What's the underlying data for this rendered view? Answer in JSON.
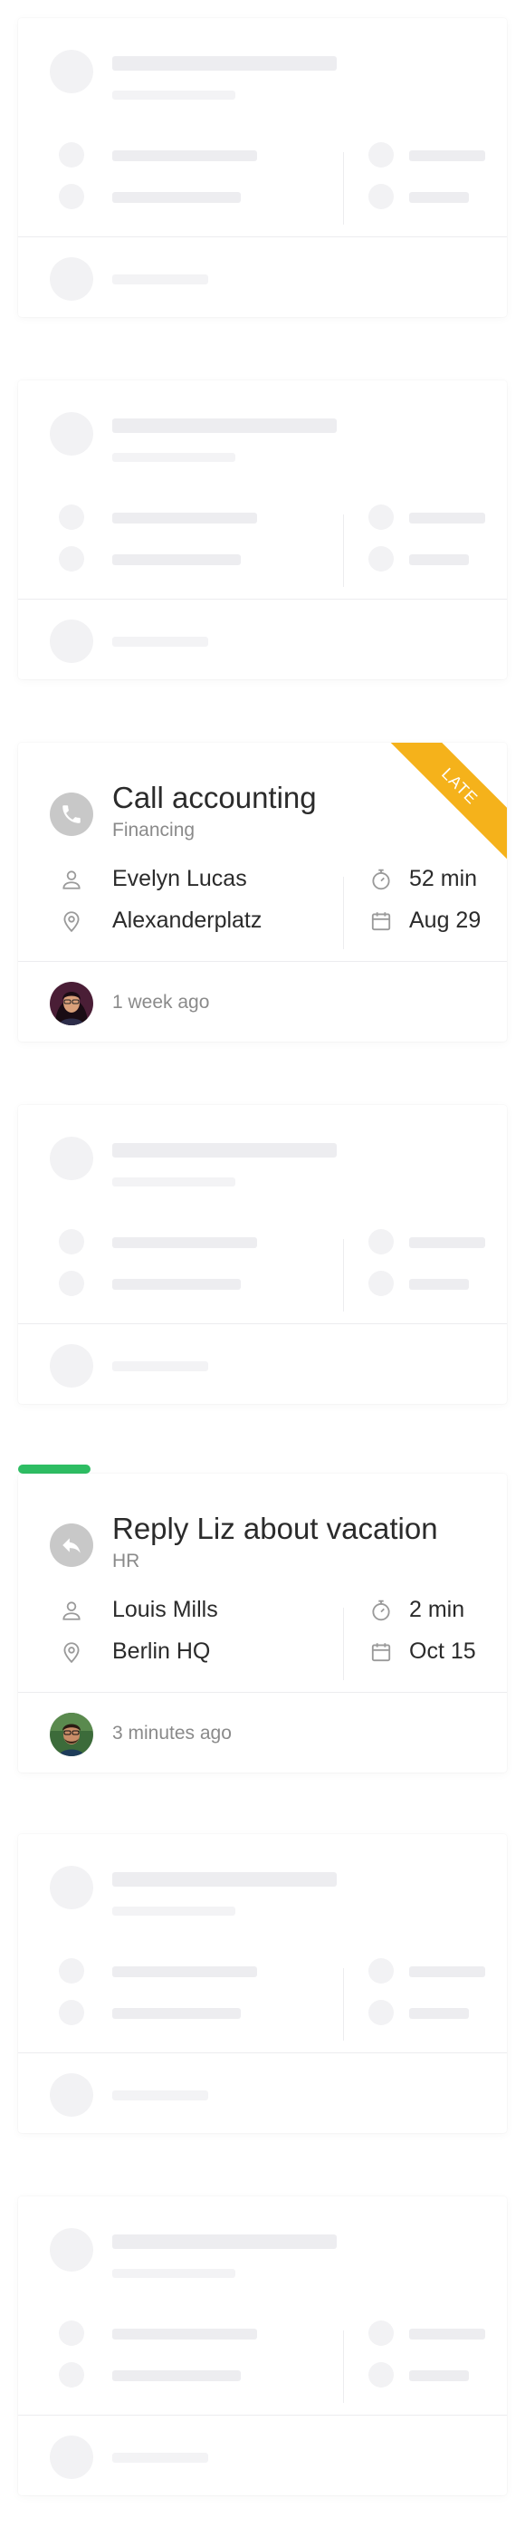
{
  "tasks": [
    {
      "title": "Call accounting",
      "category": "Financing",
      "assignee": "Evelyn Lucas",
      "location": "Alexanderplatz",
      "duration": "52 min",
      "date": "Aug 29",
      "updated": "1 week ago",
      "badge": "LATE",
      "type_icon": "phone-icon",
      "avatar_icon": "avatar-woman"
    },
    {
      "title": "Reply Liz about vacation",
      "category": "HR",
      "assignee": "Louis Mills",
      "location": "Berlin HQ",
      "duration": "2 min",
      "date": "Oct 15",
      "updated": "3 minutes ago",
      "type_icon": "reply-icon",
      "avatar_icon": "avatar-man",
      "status_color": "#2ebd63"
    }
  ],
  "colors": {
    "late_badge": "#f5b21b",
    "status_bar": "#2ebd63",
    "icon_grey": "#c8c8c8",
    "muted_text": "#8a8a8a"
  }
}
